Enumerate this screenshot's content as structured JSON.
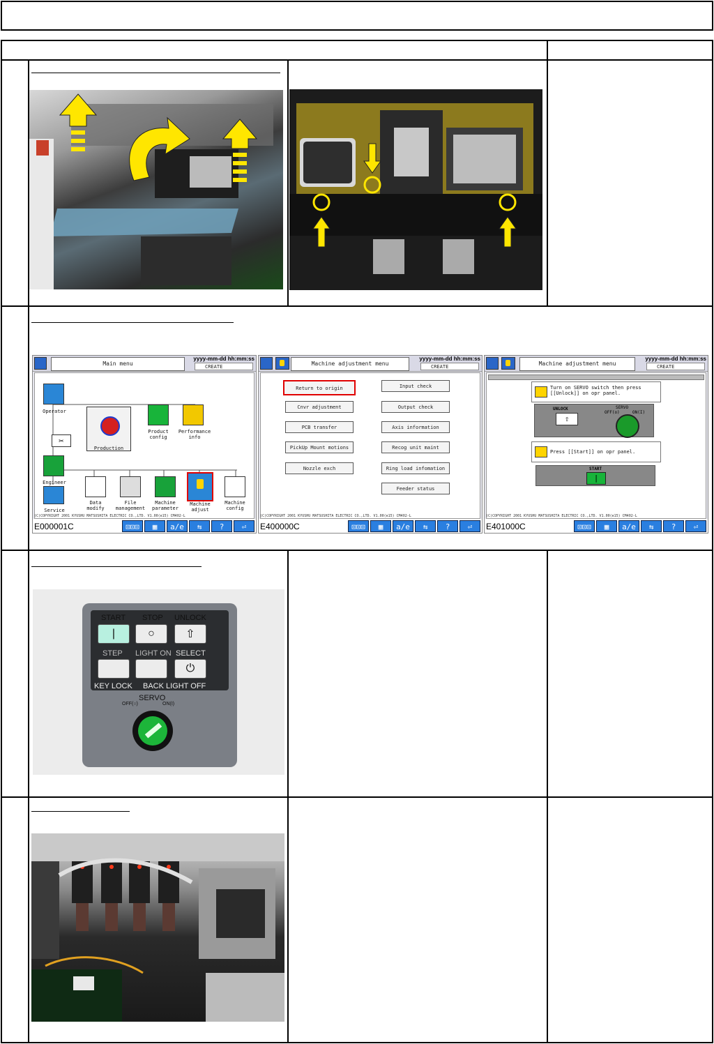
{
  "screens": [
    {
      "title": "Main menu",
      "date": "yyyy-mm-dd hh:mm:ss",
      "create": "CREATE",
      "code": "E000001C",
      "copyright": "(C)COPYRIGHT 2001 KYUSHU MATSUSHITA ELECTRIC CO.,LTD. V1.00(e15) CM402-L",
      "icons": {
        "operator": "Operator",
        "production": "Production",
        "product_config": "Product config",
        "performance_info": "Performance info",
        "engineer": "Engineer",
        "service": "Service",
        "data_modify": "Data modify",
        "file_management": "File management",
        "machine_parameter": "Machine parameter",
        "machine_adjust": "Machine adjust",
        "machine_config": "Machine config"
      }
    },
    {
      "title": "Machine adjustment menu",
      "date": "yyyy-mm-dd hh:mm:ss",
      "create": "CREATE",
      "code": "E400000C",
      "copyright": "(C)COPYRIGHT 2001 KYUSHU MATSUSHITA ELECTRIC CO.,LTD. V1.00(e15) CM402-L",
      "buttons_left": [
        "Return to origin",
        "Cnvr adjustment",
        "PCB transfer",
        "PickUp Mount motions",
        "Nozzle exch"
      ],
      "buttons_right": [
        "Input check",
        "Output check",
        "Axis information",
        "Recog unit maint",
        "Ring load infomation",
        "Feeder status"
      ]
    },
    {
      "title": "Machine adjustment menu",
      "date": "yyyy-mm-dd hh:mm:ss",
      "create": "CREATE",
      "code": "E401000C",
      "copyright": "(C)COPYRIGHT 2001 KYUSHU MATSUSHITA ELECTRIC CO.,LTD. V1.00(e15) CM402-L",
      "msg1": "Turn on SERVO switch then press [[Unlock]] on opr panel.",
      "unlock": "UNLOCK",
      "servo": "SERVO",
      "off": "OFF(o)",
      "on": "ON(I)",
      "msg2": "Press [[Start]] on opr panel.",
      "start": "START"
    }
  ],
  "fkeys": [
    "⊡⊡⊡",
    "▦",
    "a/e",
    "⇆",
    "?",
    "⏎"
  ],
  "panel": {
    "start": "START",
    "stop": "STOP",
    "unlock": "UNLOCK",
    "step": "STEP",
    "light_on": "LIGHT ON",
    "select": "SELECT",
    "key_lock": "KEY LOCK",
    "back_light_off": "BACK LIGHT OFF",
    "servo": "SERVO",
    "off": "OFF(○)",
    "on": "ON(I)"
  }
}
